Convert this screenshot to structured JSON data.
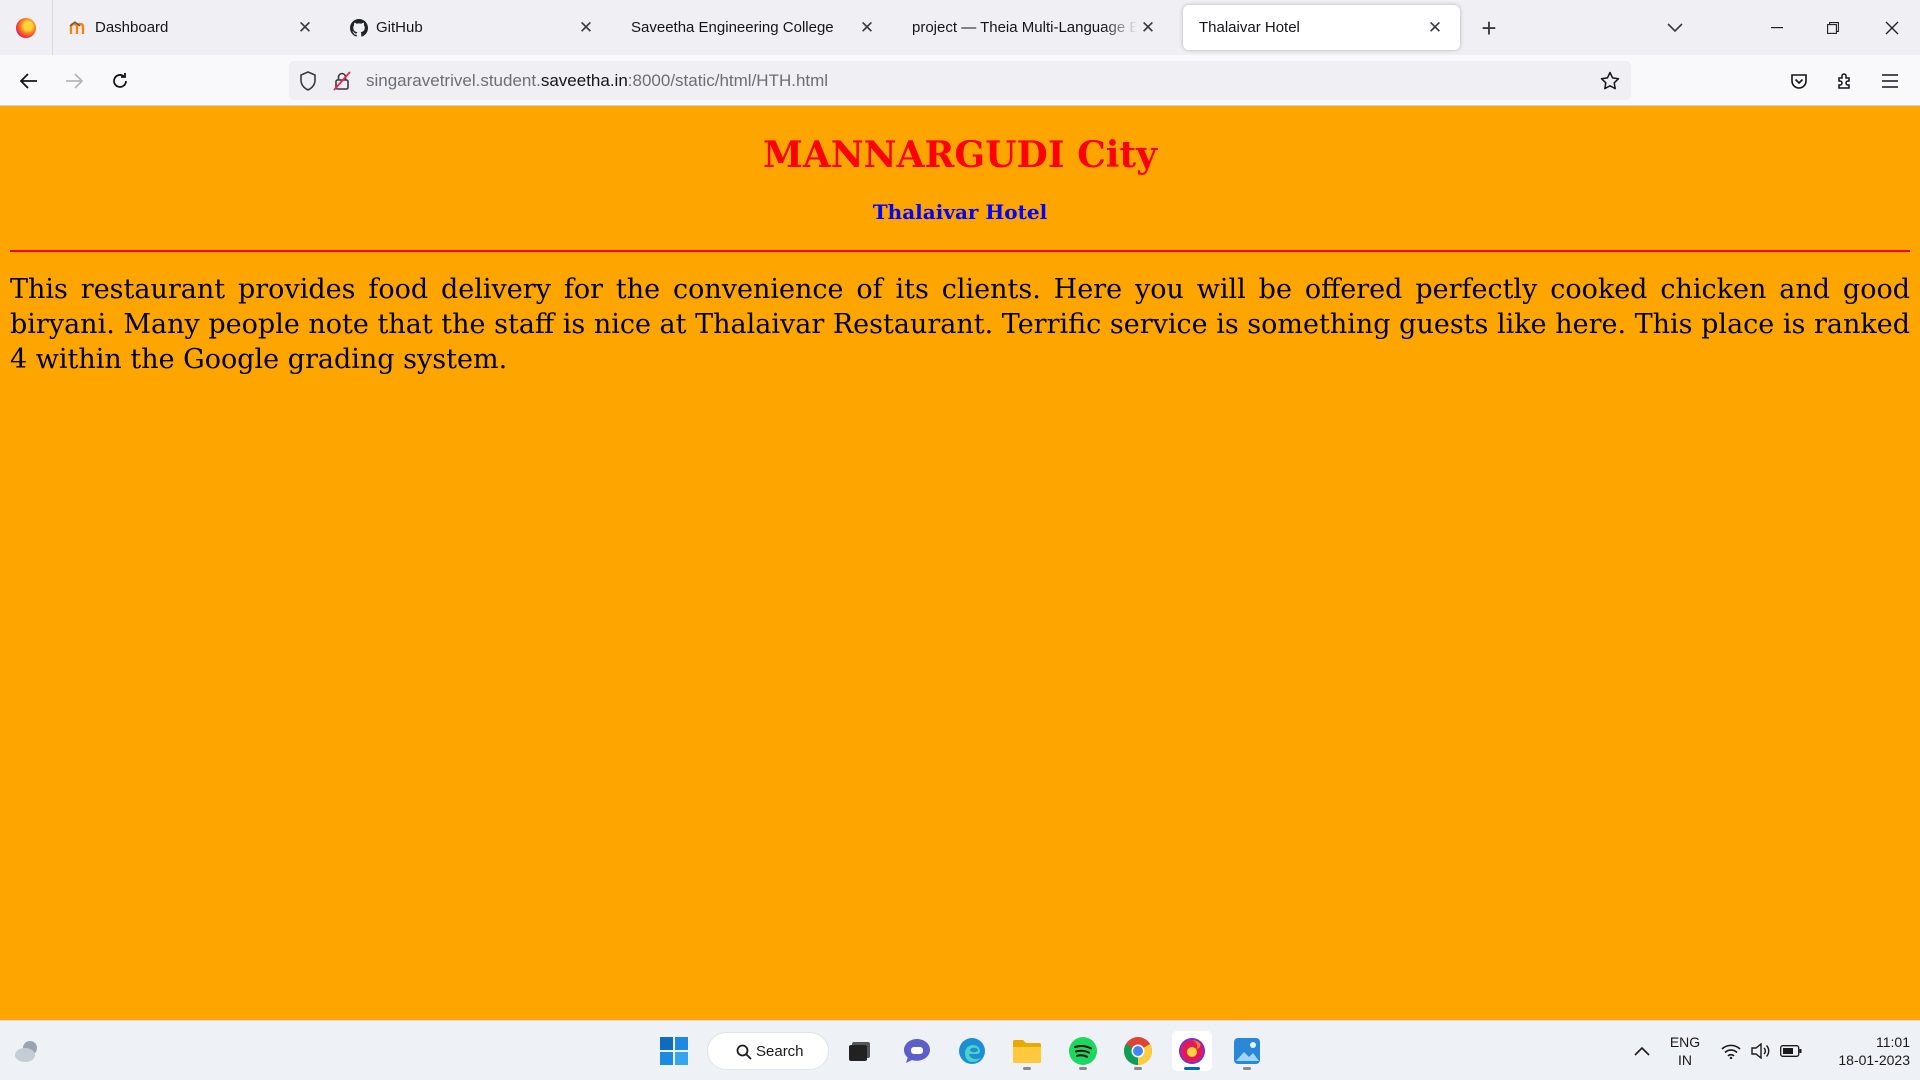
{
  "browser": {
    "tabs": [
      {
        "title": "Dashboard",
        "icon": "moodle-icon",
        "active": false
      },
      {
        "title": "GitHub",
        "icon": "github-icon",
        "active": false
      },
      {
        "title": "Saveetha Engineering College",
        "icon": "",
        "active": false
      },
      {
        "title": "project — Theia Multi-Language Ex",
        "icon": "",
        "active": false
      },
      {
        "title": "Thalaivar Hotel",
        "icon": "",
        "active": true
      }
    ],
    "url": {
      "prefix": "singaravetrivel.student.",
      "host": "saveetha.in",
      "suffix": ":8000/static/html/HTH.html"
    }
  },
  "page": {
    "heading": "MANNARGUDI City",
    "subheading": "Thalaivar Hotel",
    "paragraph": "This restaurant provides food delivery for the convenience of its clients. Here you will be offered perfectly cooked chicken and good biryani. Many people note that the staff is nice at Thalaivar Restaurant. Terrific service is something guests like here. This place is ranked 4 within the Google grading system.",
    "colors": {
      "background": "#ffa500",
      "heading": "#ff0000",
      "subheading": "#0000ff",
      "rule": "#ff0000"
    }
  },
  "taskbar": {
    "search_label": "Search",
    "language": {
      "line1": "ENG",
      "line2": "IN"
    },
    "time": "11:01",
    "date": "18-01-2023"
  }
}
